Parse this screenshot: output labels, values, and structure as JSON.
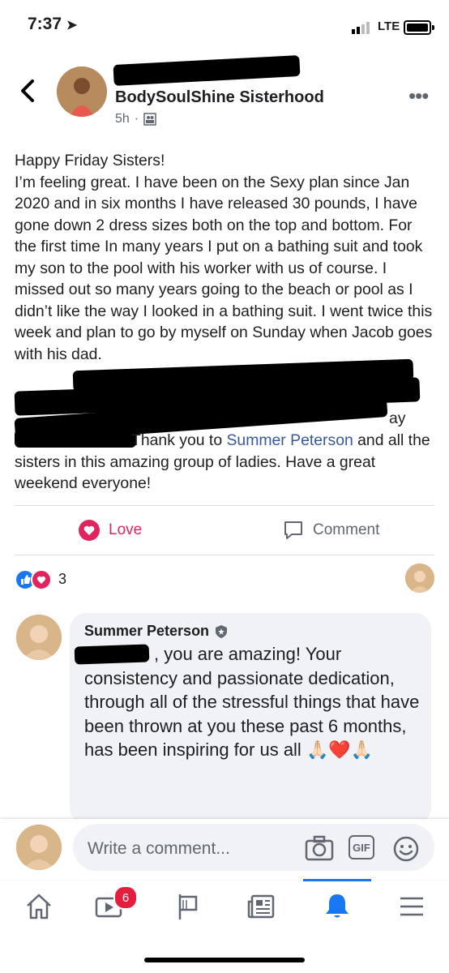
{
  "status_bar": {
    "time": "7:37",
    "network": "LTE"
  },
  "post": {
    "group_name": "BodySoulShine Sisterhood",
    "age": "5h",
    "body_lines": [
      "Happy Friday Sisters!",
      "I’m feeling great. I have been on the Sexy plan since Jan 2020 and in six months I have released 30 pounds, I have gone down 2 dress sizes both on the top and bottom. For the first time In many years I put on a bathing suit and took my son to the pool with his worker with us of course. I missed out so many years going to the beach or pool as I didn’t like the way I looked in a bathing suit. I went twice this week and plan to go by myself on Sunday when Jacob goes with his dad."
    ],
    "partial_visible": "ay",
    "thanks_prefix": "Thank you to ",
    "mention": "Summer Peterson",
    "thanks_suffix": " and all the sisters in this amazing group of ladies. Have a great weekend everyone!"
  },
  "actions": {
    "love": "Love",
    "comment": "Comment"
  },
  "reactions": {
    "count": "3"
  },
  "comment": {
    "author": "Summer Peterson",
    "text": ", you are amazing! Your consistency and passionate dedication, through all of the stressful things that have been thrown at you these past 6 months, has been inspiring for us all",
    "emoji": "🙏🏻❤️🙏🏻"
  },
  "composer": {
    "placeholder": "Write a comment...",
    "gif_label": "GIF"
  },
  "tabbar": {
    "video_badge": "6"
  },
  "colors": {
    "accent": "#1877f2",
    "love": "#e0245e",
    "link": "#385898",
    "bubble": "#f0f2f5"
  }
}
